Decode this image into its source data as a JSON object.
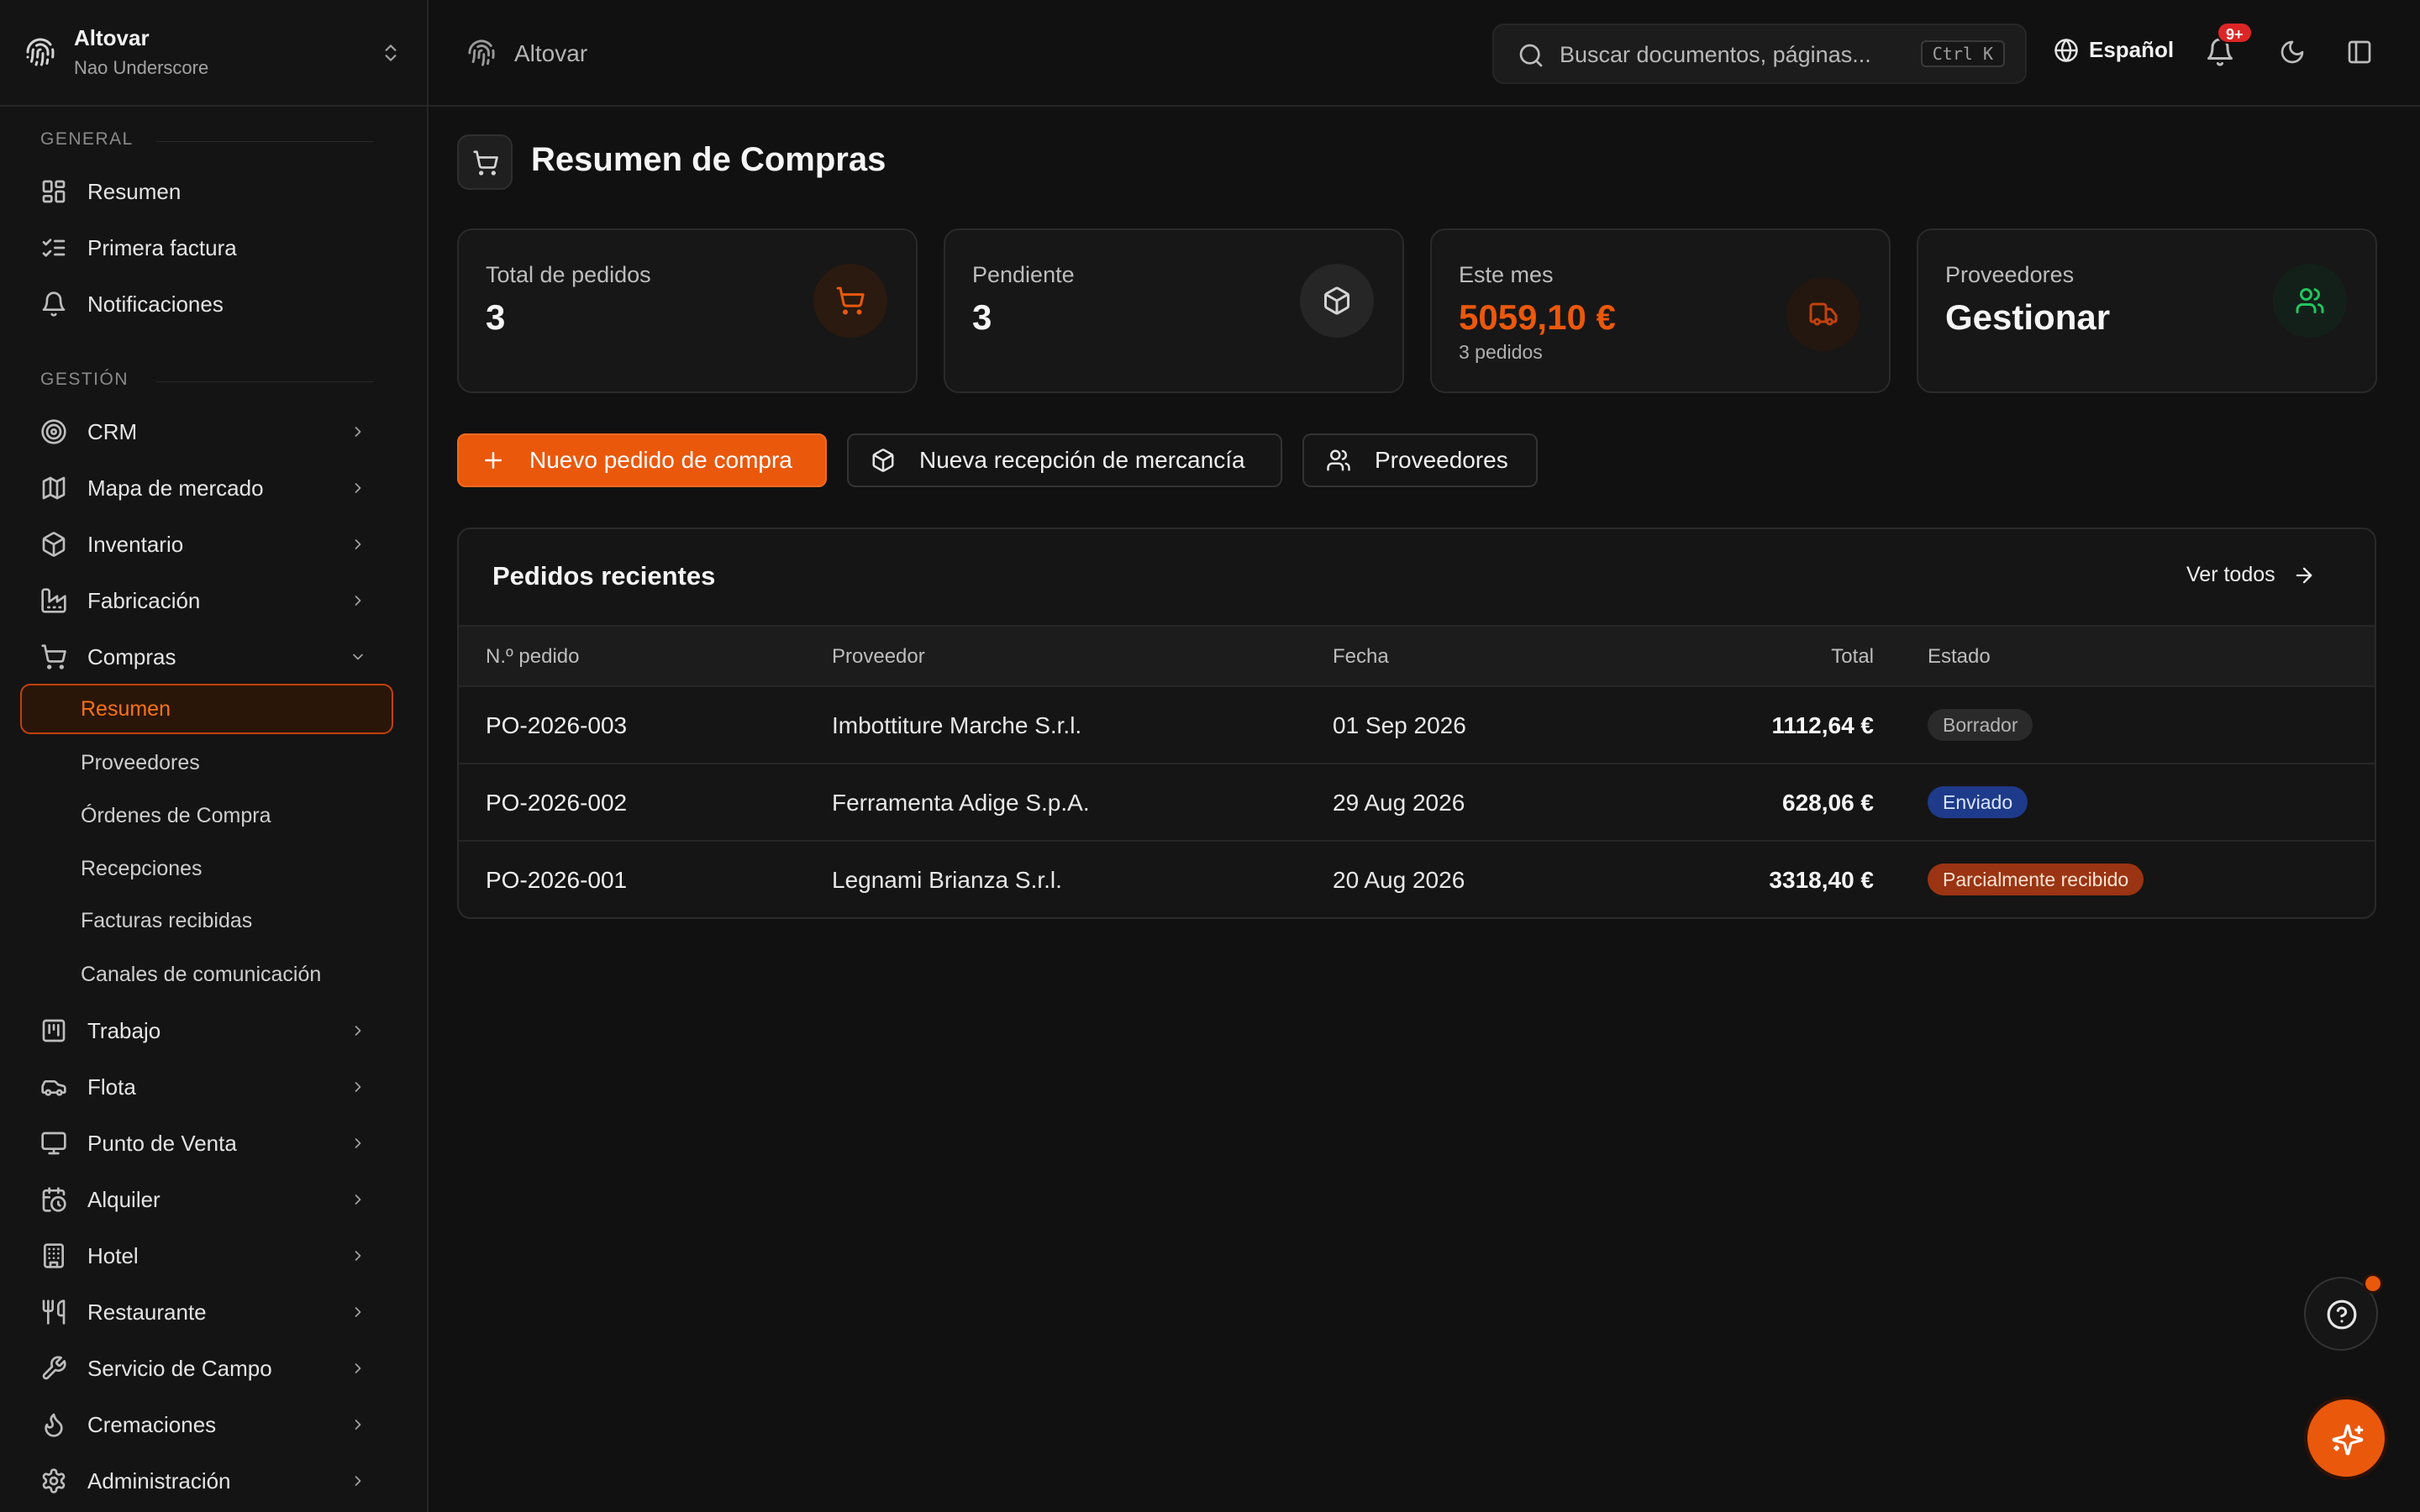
{
  "workspace": {
    "name": "Altovar",
    "subtitle": "Nao Underscore"
  },
  "sidebar": {
    "general_label": "GENERAL",
    "gestion_label": "GESTIÓN",
    "general": [
      {
        "label": "Resumen",
        "icon": "dashboard-icon"
      },
      {
        "label": "Primera factura",
        "icon": "checklist-icon"
      },
      {
        "label": "Notificaciones",
        "icon": "bell-icon"
      }
    ],
    "gestion": [
      {
        "label": "CRM",
        "icon": "target-icon"
      },
      {
        "label": "Mapa de mercado",
        "icon": "map-icon"
      },
      {
        "label": "Inventario",
        "icon": "box-icon"
      },
      {
        "label": "Fabricación",
        "icon": "factory-icon"
      },
      {
        "label": "Compras",
        "icon": "cart-icon",
        "expanded": true
      }
    ],
    "compras_sub": [
      {
        "label": "Resumen",
        "active": true
      },
      {
        "label": "Proveedores"
      },
      {
        "label": "Órdenes de Compra"
      },
      {
        "label": "Recepciones"
      },
      {
        "label": "Facturas recibidas"
      },
      {
        "label": "Canales de comunicación"
      }
    ],
    "gestion_more": [
      {
        "label": "Trabajo",
        "icon": "kanban-icon"
      },
      {
        "label": "Flota",
        "icon": "car-icon"
      },
      {
        "label": "Punto de Venta",
        "icon": "monitor-icon"
      },
      {
        "label": "Alquiler",
        "icon": "calendar-clock-icon"
      },
      {
        "label": "Hotel",
        "icon": "building-icon"
      },
      {
        "label": "Restaurante",
        "icon": "utensils-icon"
      },
      {
        "label": "Servicio de Campo",
        "icon": "wrench-icon"
      },
      {
        "label": "Cremaciones",
        "icon": "flame-icon"
      },
      {
        "label": "Administración",
        "icon": "settings-icon"
      }
    ]
  },
  "header": {
    "breadcrumb": "Altovar",
    "search_placeholder": "Buscar documentos, páginas...",
    "search_shortcut": "Ctrl K",
    "language": "Español",
    "notifications_badge": "9+"
  },
  "page": {
    "title": "Resumen de Compras",
    "stats": [
      {
        "label": "Total de pedidos",
        "value": "3",
        "icon": "cart-icon",
        "icon_color": "#ea580c",
        "icon_bg": "#2a1a10"
      },
      {
        "label": "Pendiente",
        "value": "3",
        "icon": "package-icon",
        "icon_color": "#d4d4d4",
        "icon_bg": "#262626"
      },
      {
        "label": "Este mes",
        "value": "5059,10 €",
        "sub": "3 pedidos",
        "value_color": "#ea580c",
        "icon": "truck-icon",
        "icon_color": "#c2410c",
        "icon_bg": "#231710"
      },
      {
        "label": "Proveedores",
        "value": "Gestionar",
        "icon": "users-icon",
        "icon_color": "#22c55e",
        "icon_bg": "#13201a"
      }
    ],
    "actions": {
      "new_order": "Nuevo pedido de compra",
      "new_reception": "Nueva recepción de mercancía",
      "suppliers": "Proveedores"
    },
    "orders": {
      "title": "Pedidos recientes",
      "see_all": "Ver todos",
      "columns": [
        "N.º pedido",
        "Proveedor",
        "Fecha",
        "Total",
        "Estado"
      ],
      "rows": [
        {
          "number": "PO-2026-003",
          "supplier": "Imbottiture Marche S.r.l.",
          "date": "01 Sep 2026",
          "total": "1112,64 €",
          "status": "Borrador",
          "status_bg": "#2a2a2a",
          "status_fg": "#b5b5b5"
        },
        {
          "number": "PO-2026-002",
          "supplier": "Ferramenta Adige S.p.A.",
          "date": "29 Aug 2026",
          "total": "628,06 €",
          "status": "Enviado",
          "status_bg": "#1e3a8a",
          "status_fg": "#dbe7ff"
        },
        {
          "number": "PO-2026-001",
          "supplier": "Legnami Brianza S.r.l.",
          "date": "20 Aug 2026",
          "total": "3318,40 €",
          "status": "Parcialmente recibido",
          "status_bg": "#9a3412",
          "status_fg": "#ffe3d3"
        }
      ]
    }
  },
  "colors": {
    "accent": "#ea580c",
    "background": "#111111",
    "card": "#171717",
    "border": "#2a2a2a"
  }
}
